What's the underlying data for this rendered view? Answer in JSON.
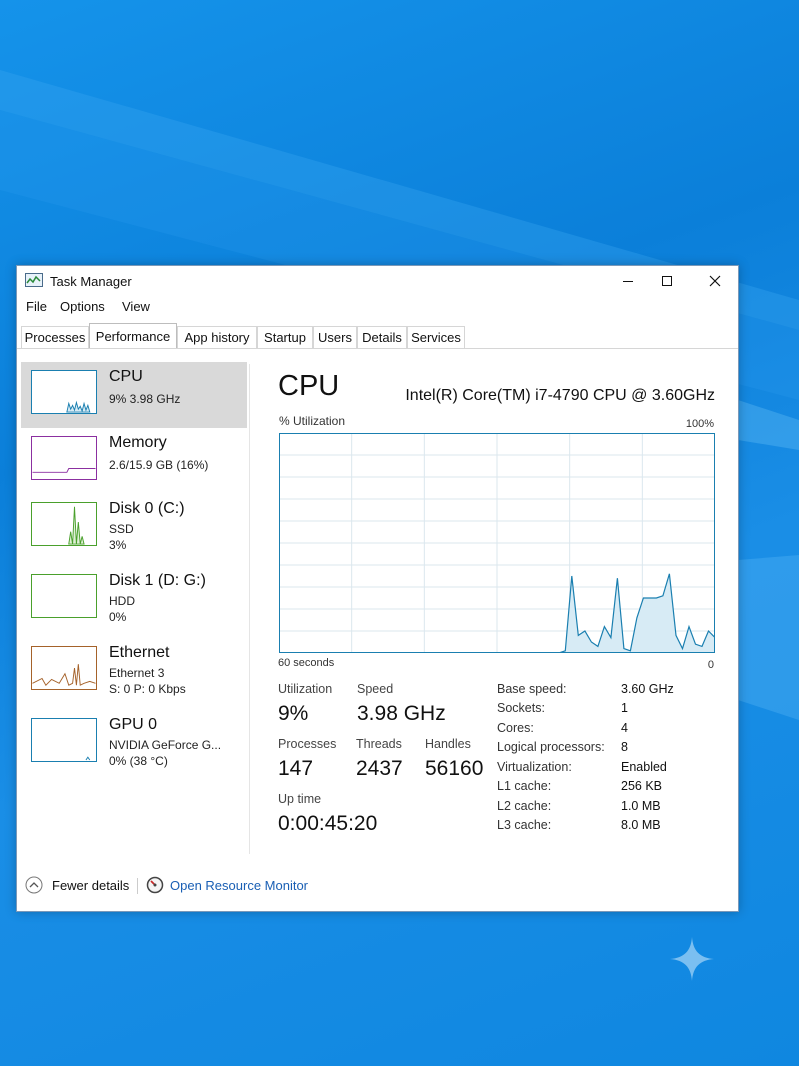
{
  "window": {
    "title": "Task Manager"
  },
  "menu": [
    "File",
    "Options",
    "View"
  ],
  "tabs": [
    "Processes",
    "Performance",
    "App history",
    "Startup",
    "Users",
    "Details",
    "Services"
  ],
  "active_tab": "Performance",
  "sidebar": [
    {
      "title": "CPU",
      "sub1": "9% 3.98 GHz",
      "sub2": "",
      "color": "#1a7fb0",
      "selected": true
    },
    {
      "title": "Memory",
      "sub1": "2.6/15.9 GB (16%)",
      "sub2": "",
      "color": "#8b2fa0"
    },
    {
      "title": "Disk 0 (C:)",
      "sub1": "SSD",
      "sub2": "3%",
      "color": "#4aa02c"
    },
    {
      "title": "Disk 1 (D: G:)",
      "sub1": "HDD",
      "sub2": "0%",
      "color": "#4aa02c"
    },
    {
      "title": "Ethernet",
      "sub1": "Ethernet 3",
      "sub2": "S: 0 P: 0 Kbps",
      "color": "#a5622a"
    },
    {
      "title": "GPU 0",
      "sub1": "NVIDIA GeForce G...",
      "sub2": "0% (38 °C)",
      "color": "#1a7fb0"
    }
  ],
  "main": {
    "title": "CPU",
    "model": "Intel(R) Core(TM) i7-4790 CPU @ 3.60GHz",
    "util_label": "% Utilization",
    "max_label": "100%",
    "time_left": "60 seconds",
    "time_right": "0"
  },
  "stats": {
    "utilization": {
      "label": "Utilization",
      "value": "9%"
    },
    "speed": {
      "label": "Speed",
      "value": "3.98 GHz"
    },
    "processes": {
      "label": "Processes",
      "value": "147"
    },
    "threads": {
      "label": "Threads",
      "value": "2437"
    },
    "handles": {
      "label": "Handles",
      "value": "56160"
    },
    "uptime": {
      "label": "Up time",
      "value": "0:00:45:20"
    }
  },
  "specs": [
    {
      "label": "Base speed:",
      "value": "3.60 GHz"
    },
    {
      "label": "Sockets:",
      "value": "1"
    },
    {
      "label": "Cores:",
      "value": "4"
    },
    {
      "label": "Logical processors:",
      "value": "8"
    },
    {
      "label": "Virtualization:",
      "value": "Enabled"
    },
    {
      "label": "L1 cache:",
      "value": "256 KB"
    },
    {
      "label": "L2 cache:",
      "value": "1.0 MB"
    },
    {
      "label": "L3 cache:",
      "value": "8.0 MB"
    }
  ],
  "cpu_history_percent": [
    0,
    0,
    0,
    0,
    0,
    0,
    0,
    0,
    0,
    0,
    0,
    0,
    0,
    0,
    0,
    0,
    0,
    0,
    0,
    0,
    0,
    0,
    0,
    0,
    0,
    0,
    0,
    0,
    0,
    0,
    0,
    0,
    0,
    0,
    0,
    0,
    0,
    0,
    0,
    0,
    0,
    0,
    0,
    0,
    1,
    35,
    8,
    10,
    5,
    3,
    12,
    7,
    34,
    2,
    1,
    16,
    25,
    25,
    25,
    26,
    36,
    8,
    2,
    12,
    4,
    3,
    10,
    7
  ],
  "footer": {
    "fewer": "Fewer details",
    "monitor": "Open Resource Monitor"
  },
  "colors": {
    "cpu_line": "#1a7fb0",
    "cpu_fill": "#d7ebf5",
    "grid": "#dbe7ee",
    "link": "#1a5fb4"
  }
}
